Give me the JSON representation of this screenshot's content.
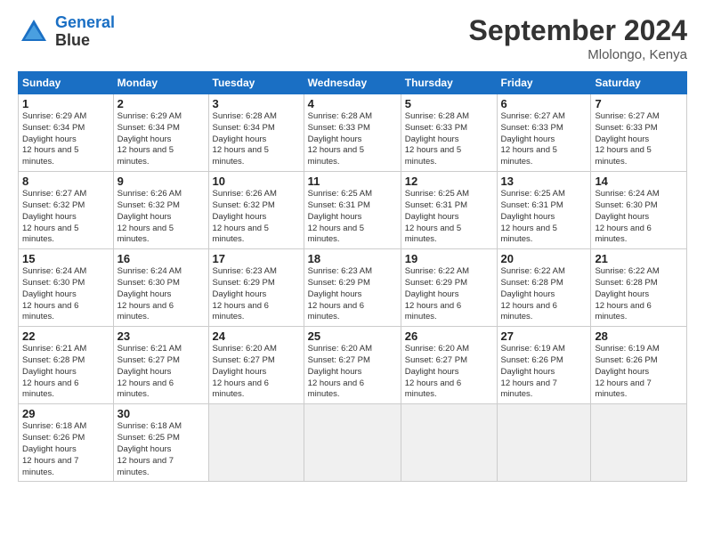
{
  "header": {
    "logo_line1": "General",
    "logo_line2": "Blue",
    "month": "September 2024",
    "location": "Mlolongo, Kenya"
  },
  "weekdays": [
    "Sunday",
    "Monday",
    "Tuesday",
    "Wednesday",
    "Thursday",
    "Friday",
    "Saturday"
  ],
  "weeks": [
    [
      {
        "day": 1,
        "sunrise": "6:29 AM",
        "sunset": "6:34 PM",
        "daylight": "12 hours and 5 minutes."
      },
      {
        "day": 2,
        "sunrise": "6:29 AM",
        "sunset": "6:34 PM",
        "daylight": "12 hours and 5 minutes."
      },
      {
        "day": 3,
        "sunrise": "6:28 AM",
        "sunset": "6:34 PM",
        "daylight": "12 hours and 5 minutes."
      },
      {
        "day": 4,
        "sunrise": "6:28 AM",
        "sunset": "6:33 PM",
        "daylight": "12 hours and 5 minutes."
      },
      {
        "day": 5,
        "sunrise": "6:28 AM",
        "sunset": "6:33 PM",
        "daylight": "12 hours and 5 minutes."
      },
      {
        "day": 6,
        "sunrise": "6:27 AM",
        "sunset": "6:33 PM",
        "daylight": "12 hours and 5 minutes."
      },
      {
        "day": 7,
        "sunrise": "6:27 AM",
        "sunset": "6:33 PM",
        "daylight": "12 hours and 5 minutes."
      }
    ],
    [
      {
        "day": 8,
        "sunrise": "6:27 AM",
        "sunset": "6:32 PM",
        "daylight": "12 hours and 5 minutes."
      },
      {
        "day": 9,
        "sunrise": "6:26 AM",
        "sunset": "6:32 PM",
        "daylight": "12 hours and 5 minutes."
      },
      {
        "day": 10,
        "sunrise": "6:26 AM",
        "sunset": "6:32 PM",
        "daylight": "12 hours and 5 minutes."
      },
      {
        "day": 11,
        "sunrise": "6:25 AM",
        "sunset": "6:31 PM",
        "daylight": "12 hours and 5 minutes."
      },
      {
        "day": 12,
        "sunrise": "6:25 AM",
        "sunset": "6:31 PM",
        "daylight": "12 hours and 5 minutes."
      },
      {
        "day": 13,
        "sunrise": "6:25 AM",
        "sunset": "6:31 PM",
        "daylight": "12 hours and 5 minutes."
      },
      {
        "day": 14,
        "sunrise": "6:24 AM",
        "sunset": "6:30 PM",
        "daylight": "12 hours and 6 minutes."
      }
    ],
    [
      {
        "day": 15,
        "sunrise": "6:24 AM",
        "sunset": "6:30 PM",
        "daylight": "12 hours and 6 minutes."
      },
      {
        "day": 16,
        "sunrise": "6:24 AM",
        "sunset": "6:30 PM",
        "daylight": "12 hours and 6 minutes."
      },
      {
        "day": 17,
        "sunrise": "6:23 AM",
        "sunset": "6:29 PM",
        "daylight": "12 hours and 6 minutes."
      },
      {
        "day": 18,
        "sunrise": "6:23 AM",
        "sunset": "6:29 PM",
        "daylight": "12 hours and 6 minutes."
      },
      {
        "day": 19,
        "sunrise": "6:22 AM",
        "sunset": "6:29 PM",
        "daylight": "12 hours and 6 minutes."
      },
      {
        "day": 20,
        "sunrise": "6:22 AM",
        "sunset": "6:28 PM",
        "daylight": "12 hours and 6 minutes."
      },
      {
        "day": 21,
        "sunrise": "6:22 AM",
        "sunset": "6:28 PM",
        "daylight": "12 hours and 6 minutes."
      }
    ],
    [
      {
        "day": 22,
        "sunrise": "6:21 AM",
        "sunset": "6:28 PM",
        "daylight": "12 hours and 6 minutes."
      },
      {
        "day": 23,
        "sunrise": "6:21 AM",
        "sunset": "6:27 PM",
        "daylight": "12 hours and 6 minutes."
      },
      {
        "day": 24,
        "sunrise": "6:20 AM",
        "sunset": "6:27 PM",
        "daylight": "12 hours and 6 minutes."
      },
      {
        "day": 25,
        "sunrise": "6:20 AM",
        "sunset": "6:27 PM",
        "daylight": "12 hours and 6 minutes."
      },
      {
        "day": 26,
        "sunrise": "6:20 AM",
        "sunset": "6:27 PM",
        "daylight": "12 hours and 6 minutes."
      },
      {
        "day": 27,
        "sunrise": "6:19 AM",
        "sunset": "6:26 PM",
        "daylight": "12 hours and 7 minutes."
      },
      {
        "day": 28,
        "sunrise": "6:19 AM",
        "sunset": "6:26 PM",
        "daylight": "12 hours and 7 minutes."
      }
    ],
    [
      {
        "day": 29,
        "sunrise": "6:18 AM",
        "sunset": "6:26 PM",
        "daylight": "12 hours and 7 minutes."
      },
      {
        "day": 30,
        "sunrise": "6:18 AM",
        "sunset": "6:25 PM",
        "daylight": "12 hours and 7 minutes."
      },
      null,
      null,
      null,
      null,
      null
    ]
  ]
}
